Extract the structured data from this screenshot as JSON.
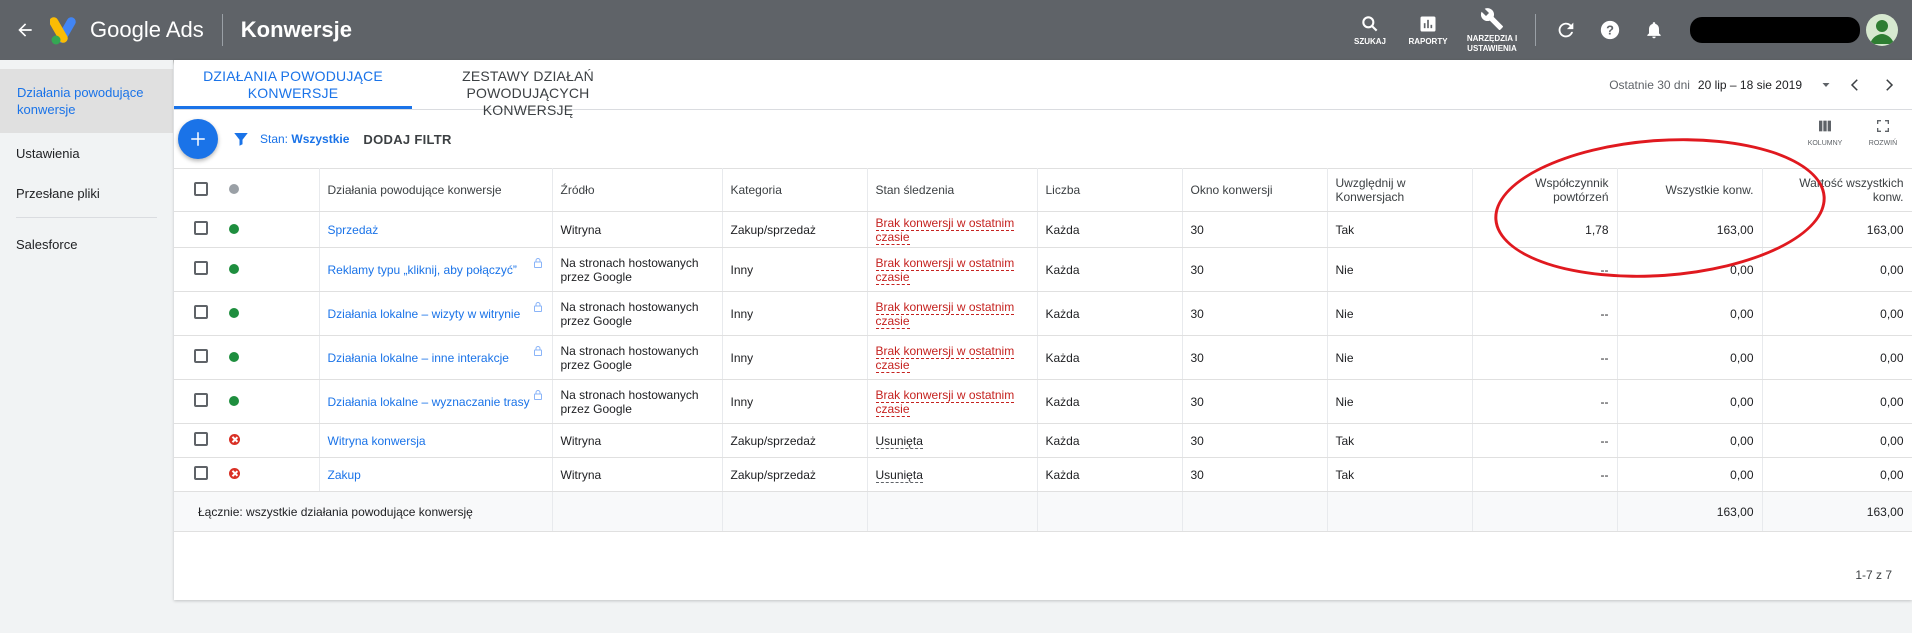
{
  "header": {
    "app_name": "Google Ads",
    "page_title": "Konwersje",
    "actions": [
      {
        "label": "SZUKAJ",
        "icon": "search-icon"
      },
      {
        "label": "RAPORTY",
        "icon": "reports-icon"
      },
      {
        "label": "NARZĘDZIA I USTAWIENIA",
        "icon": "wrench-icon"
      }
    ]
  },
  "sidebar": {
    "items": [
      {
        "label": "Działania powodujące konwersje"
      },
      {
        "label": "Ustawienia"
      },
      {
        "label": "Przesłane pliki"
      },
      {
        "label": "Salesforce"
      }
    ]
  },
  "tabs": [
    {
      "label": "DZIAŁANIA POWODUJĄCE KONWERSJE"
    },
    {
      "label": "ZESTAWY DZIAŁAŃ POWODUJĄCYCH KONWERSJĘ"
    }
  ],
  "date_range": {
    "label": "Ostatnie 30 dni",
    "value": "20 lip – 18 sie 2019"
  },
  "toolbar": {
    "filter_prefix": "Stan:",
    "filter_value": "Wszystkie",
    "add_filter": "DODAJ FILTR",
    "columns_label": "KOLUMNY",
    "expand_label": "ROZWIŃ"
  },
  "table": {
    "headers": {
      "name": "Działania powodujące konwersje",
      "source": "Źródło",
      "category": "Kategoria",
      "tracking": "Stan śledzenia",
      "count": "Liczba",
      "window": "Okno konwersji",
      "include": "Uwzględnij w Konwersjach",
      "repeat": "Współczynnik powtórzeń",
      "all_conv": "Wszystkie konw.",
      "all_value": "Wartość wszystkich konw."
    },
    "rows": [
      {
        "name": "Sprzedaż",
        "source": "Witryna",
        "category": "Zakup/sprzedaż",
        "tracking": "Brak konwersji w ostatnim czasie",
        "count": "Każda",
        "window": "30",
        "include": "Tak",
        "repeat": "1,78",
        "all_conv": "163,00",
        "all_value": "163,00",
        "status": "green"
      },
      {
        "name": "Reklamy typu „kliknij, aby połączyć”",
        "source": "Na stronach hostowanych przez Google",
        "category": "Inny",
        "tracking": "Brak konwersji w ostatnim czasie",
        "count": "Każda",
        "window": "30",
        "include": "Nie",
        "repeat": "--",
        "all_conv": "0,00",
        "all_value": "0,00",
        "status": "green"
      },
      {
        "name": "Działania lokalne – wizyty w witrynie",
        "source": "Na stronach hostowanych przez Google",
        "category": "Inny",
        "tracking": "Brak konwersji w ostatnim czasie",
        "count": "Każda",
        "window": "30",
        "include": "Nie",
        "repeat": "--",
        "all_conv": "0,00",
        "all_value": "0,00",
        "status": "green"
      },
      {
        "name": "Działania lokalne – inne interakcje",
        "source": "Na stronach hostowanych przez Google",
        "category": "Inny",
        "tracking": "Brak konwersji w ostatnim czasie",
        "count": "Każda",
        "window": "30",
        "include": "Nie",
        "repeat": "--",
        "all_conv": "0,00",
        "all_value": "0,00",
        "status": "green"
      },
      {
        "name": "Działania lokalne – wyznaczanie trasy",
        "source": "Na stronach hostowanych przez Google",
        "category": "Inny",
        "tracking": "Brak konwersji w ostatnim czasie",
        "count": "Każda",
        "window": "30",
        "include": "Nie",
        "repeat": "--",
        "all_conv": "0,00",
        "all_value": "0,00",
        "status": "green"
      },
      {
        "name": "Witryna konwersja",
        "source": "Witryna",
        "category": "Zakup/sprzedaż",
        "tracking": "Usunięta",
        "count": "Każda",
        "window": "30",
        "include": "Tak",
        "repeat": "--",
        "all_conv": "0,00",
        "all_value": "0,00",
        "status": "removed"
      },
      {
        "name": "Zakup",
        "source": "Witryna",
        "category": "Zakup/sprzedaż",
        "tracking": "Usunięta",
        "count": "Każda",
        "window": "30",
        "include": "Tak",
        "repeat": "--",
        "all_conv": "0,00",
        "all_value": "0,00",
        "status": "removed"
      }
    ],
    "total": {
      "label": "Łącznie: wszystkie działania powodujące konwersję",
      "all_conv": "163,00",
      "all_value": "163,00"
    }
  },
  "pagination": "1-7 z 7",
  "colors": {
    "topbar": "#5f6368",
    "accent": "#1a73e8",
    "success": "#1e8e3e",
    "error": "#d93025",
    "annotation": "#e0191f"
  }
}
